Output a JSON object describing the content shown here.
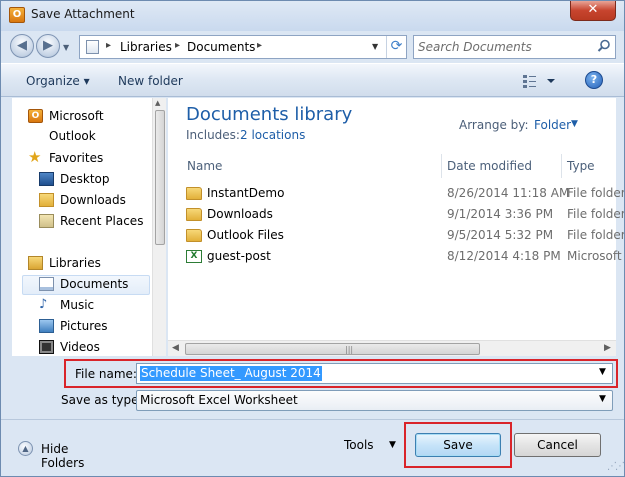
{
  "window": {
    "title": "Save Attachment",
    "close_glyph": "✕",
    "app_icon_letter": "O"
  },
  "address_bar": {
    "breadcrumbs": [
      "Libraries",
      "Documents"
    ],
    "separator_glyph": "▸"
  },
  "search": {
    "placeholder": "Search Documents"
  },
  "toolbar": {
    "organize_label": "Organize ▾",
    "new_folder_label": "New folder",
    "help_glyph": "?"
  },
  "nav_pane": {
    "items": [
      {
        "label": "Microsoft Outlook",
        "icon": "outlook-icon"
      },
      {
        "label": "Favorites",
        "icon": "star-icon"
      },
      {
        "label": "Desktop",
        "icon": "desktop-icon"
      },
      {
        "label": "Downloads",
        "icon": "downloads-folder-icon"
      },
      {
        "label": "Recent Places",
        "icon": "recent-places-icon"
      },
      {
        "label": "Libraries",
        "icon": "libraries-icon"
      },
      {
        "label": "Documents",
        "icon": "documents-icon",
        "selected": true
      },
      {
        "label": "Music",
        "icon": "music-icon"
      },
      {
        "label": "Pictures",
        "icon": "pictures-icon"
      },
      {
        "label": "Videos",
        "icon": "videos-icon"
      }
    ]
  },
  "library": {
    "title": "Documents library",
    "includes_label": "Includes:",
    "locations_link": "2 locations",
    "arrange_label": "Arrange by:",
    "arrange_value": "Folder"
  },
  "file_list": {
    "columns": [
      "Name",
      "Date modified",
      "Type"
    ],
    "rows": [
      {
        "name": "InstantDemo",
        "date": "8/26/2014 11:18 AM",
        "type": "File folder",
        "icon": "folder-icon"
      },
      {
        "name": "Downloads",
        "date": "9/1/2014 3:36 PM",
        "type": "File folder",
        "icon": "folder-icon"
      },
      {
        "name": "Outlook Files",
        "date": "9/5/2014 5:32 PM",
        "type": "File folder",
        "icon": "folder-icon"
      },
      {
        "name": "guest-post",
        "date": "8/12/2014 4:18 PM",
        "type": "Microsoft Excel",
        "icon": "excel-file-icon"
      }
    ]
  },
  "form": {
    "filename_label": "File name:",
    "filename_value": "Schedule Sheet_ August 2014",
    "savetype_label": "Save as type:",
    "savetype_value": "Microsoft Excel Worksheet"
  },
  "footer": {
    "hide_folders_label": "Hide Folders",
    "tools_label": "Tools",
    "save_label": "Save",
    "cancel_label": "Cancel"
  },
  "colors": {
    "accent_blue": "#1e5ea8",
    "highlight_red": "#d9242a",
    "selection_blue": "#3399ff",
    "chrome_blue": "#dbe6f3"
  }
}
